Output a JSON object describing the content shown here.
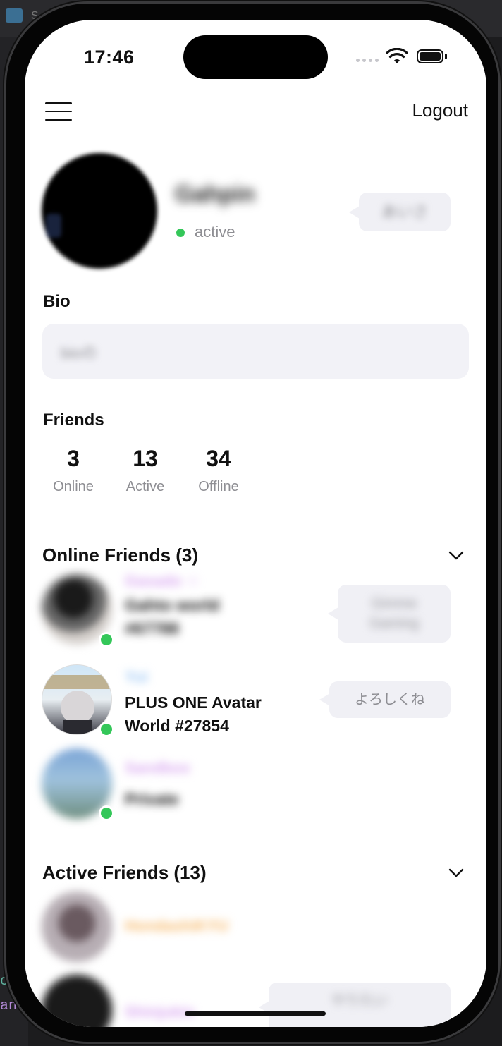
{
  "background": {
    "title_fragment": "S",
    "code_line_1": "c",
    "code_line_2": "an"
  },
  "status_bar": {
    "time": "17:46"
  },
  "header": {
    "logout_label": "Logout"
  },
  "profile": {
    "display_name": "Gahpin",
    "status_text": "active",
    "status_color": "#34c759",
    "status_message": "あいさ"
  },
  "bio": {
    "label": "Bio",
    "text": "bioの"
  },
  "friends": {
    "label": "Friends",
    "stats": [
      {
        "value": "3",
        "label": "Online"
      },
      {
        "value": "13",
        "label": "Active"
      },
      {
        "value": "34",
        "label": "Offline"
      }
    ]
  },
  "online_friends": {
    "header": "Online Friends (3)",
    "items": [
      {
        "name": "Gasado ☆",
        "name_color": "#d9a8f0",
        "location_line1": "Gahto world",
        "location_line2": "#67788",
        "message_line1": "Gimme",
        "message_line2": "Gaming"
      },
      {
        "name": "Yui",
        "name_color": "#9ec8f5",
        "location_line1": "PLUS ONE Avatar",
        "location_line2": "World #27854",
        "message_line1": "よろしくね"
      },
      {
        "name": "Sandbox",
        "name_color": "#d9a8f0",
        "location_line1": "Private"
      }
    ]
  },
  "active_friends": {
    "header": "Active Friends (13)",
    "items": [
      {
        "name": "HondashiKYU",
        "name_color": "#f7b96a"
      },
      {
        "name": "Shinjukin",
        "name_color": "#d9a8f0",
        "message_line1": "やりたい"
      }
    ]
  }
}
